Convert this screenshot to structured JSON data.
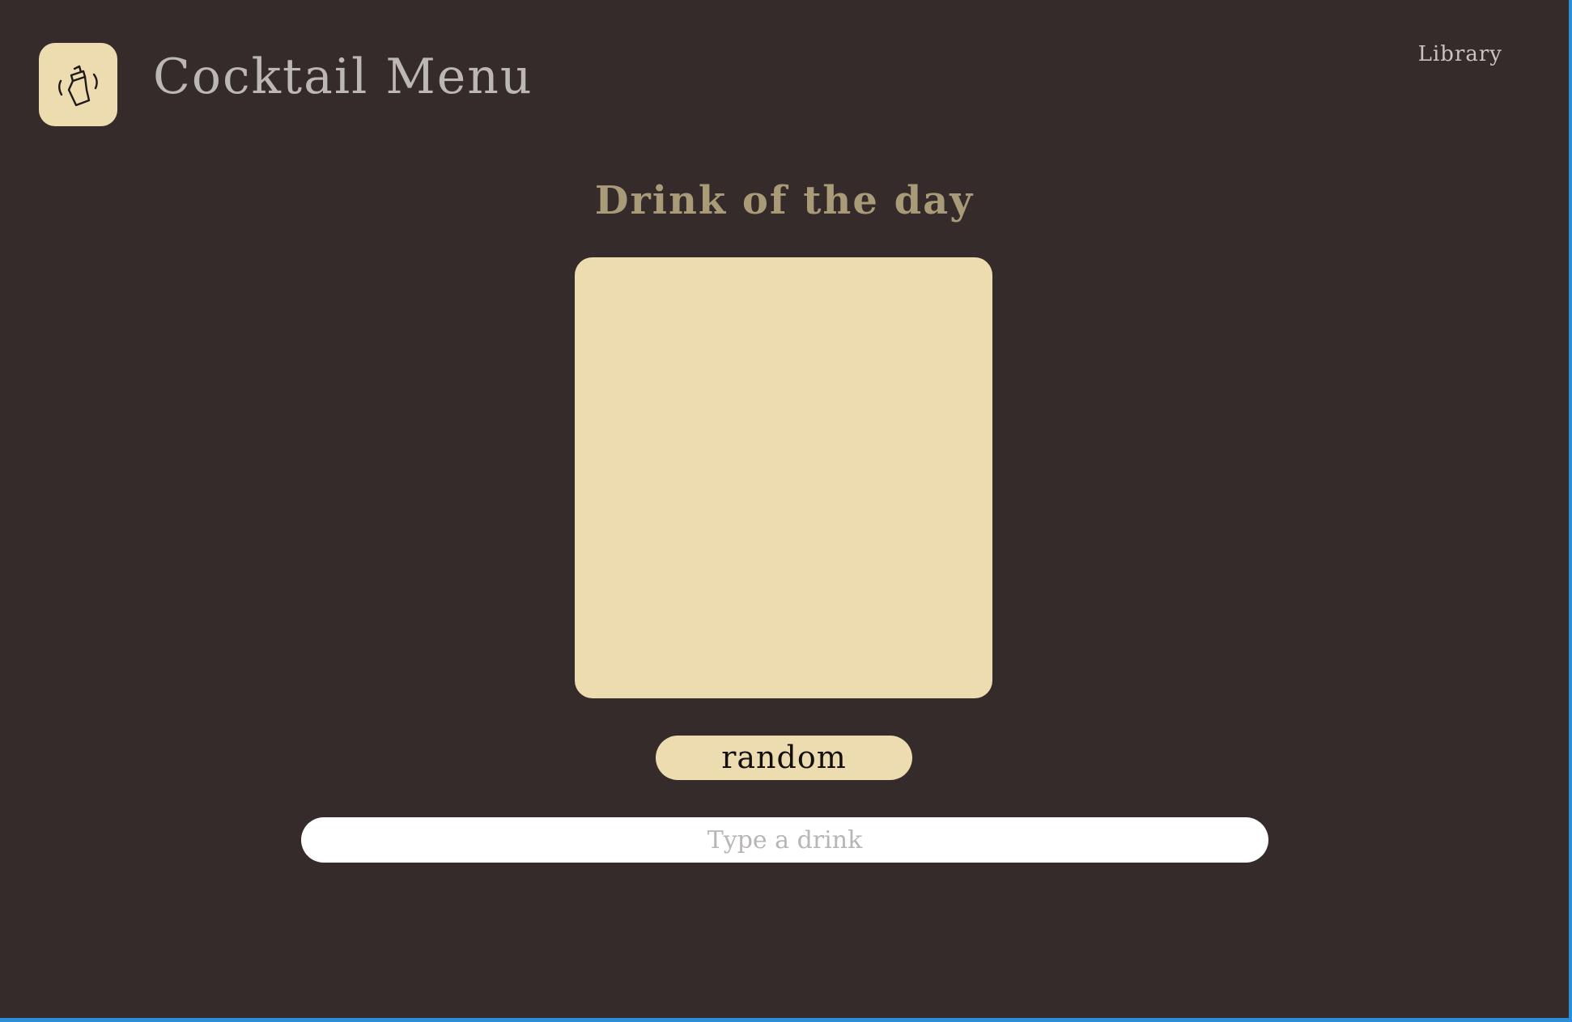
{
  "header": {
    "logo_icon": "cocktail-shaker-icon",
    "title": "Cocktail Menu",
    "nav": {
      "library_label": "Library"
    }
  },
  "main": {
    "section_title": "Drink of the day",
    "random_button_label": "random",
    "search": {
      "value": "",
      "placeholder": "Type a drink"
    }
  },
  "colors": {
    "background": "#352b2b",
    "accent": "#ecdcb0",
    "section_title": "#a99b78",
    "app_title": "#bbb7b3",
    "frame_edge": "#2a8fd8"
  }
}
